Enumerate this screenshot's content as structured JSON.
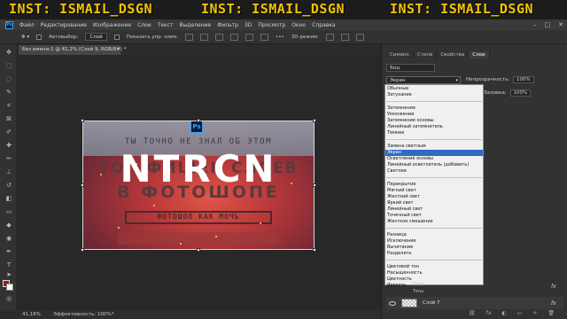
{
  "watermark": {
    "items": [
      "INST: ISMAIL_DSGN",
      "INST: ISMAIL_DSGN",
      "INST: ISMAIL_DSGN"
    ],
    "color": "#f5c400"
  },
  "menubar": {
    "logo": "Ps",
    "items": [
      "Файл",
      "Редактирование",
      "Изображение",
      "Слои",
      "Текст",
      "Выделение",
      "Фильтр",
      "3D",
      "Просмотр",
      "Окно",
      "Справка"
    ]
  },
  "options": {
    "autoselect_label": "Автовыбор:",
    "autoselect_value": "Слой",
    "show_controls_label": "Показать упр. элем.",
    "mode_3d_label": "3D-режим:"
  },
  "document": {
    "tab_title": "Без имени-1 @ 41,2% (Слой 9, RGB/8#) *",
    "zoom": "41,16%",
    "efficiency": "Эффективность: 100%*"
  },
  "artwork": {
    "line1": "ТЫ ТОЧНО НЕ ЗНАЛ ОБ ЭТОМ",
    "line2": "ТОП ФИШЕК СЛОЁВ",
    "line3": "В ФОТОШОПЕ",
    "line4": "ФОТОШОП КАК МОЧЬ",
    "badge": "Ps",
    "overlay_text": "NTRCN"
  },
  "panel": {
    "tabs": [
      "Символ",
      "Стили",
      "Свойства",
      "Слои"
    ],
    "active_tab": "Слои",
    "kind": "Вид",
    "blend_mode": "Экран",
    "opacity_label": "Непрозрачность:",
    "opacity_value": "100%",
    "fill_label": "Заливка:",
    "fill_value": "100%"
  },
  "blend_groups": [
    [
      "Обычные",
      "Затухание"
    ],
    [
      "Затемнение",
      "Умножение",
      "Затемнение основы",
      "Линейный затемнитель",
      "Темнее"
    ],
    [
      "Замена светлым",
      "Экран",
      "Осветление основы",
      "Линейный осветлитель (добавить)",
      "Светлее"
    ],
    [
      "Перекрытие",
      "Мягкий свет",
      "Жесткий свет",
      "Яркий свет",
      "Линейный свет",
      "Точечный свет",
      "Жесткое смешение"
    ],
    [
      "Разница",
      "Исключение",
      "Вычитание",
      "Разделить"
    ],
    [
      "Цветовой тон",
      "Насыщенность",
      "Цветность",
      "Яркость"
    ]
  ],
  "selected_blend": "Экран",
  "layers": {
    "shadow_label_1": "Тень",
    "shadow_label_2": "Тень",
    "layer_name": "Слой 7",
    "fx": "fx"
  }
}
